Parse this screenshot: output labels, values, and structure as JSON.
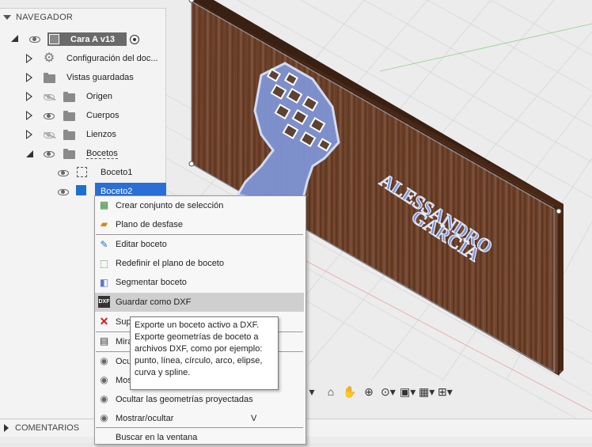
{
  "navigator": {
    "title": "NAVEGADOR",
    "component_name": "Cara A v13",
    "items": [
      {
        "label": "Configuración del doc...",
        "icon": "gear-icon"
      },
      {
        "label": "Vistas guardadas",
        "icon": "folder-icon"
      },
      {
        "label": "Origen",
        "icon": "folder-icon"
      },
      {
        "label": "Cuerpos",
        "icon": "folder-icon"
      },
      {
        "label": "Lienzos",
        "icon": "folder-icon"
      },
      {
        "label": "Bocetos",
        "icon": "folder-icon"
      }
    ],
    "sketches": [
      {
        "label": "Boceto1"
      },
      {
        "label": "Boceto2"
      }
    ]
  },
  "comments": {
    "title": "COMENTARIOS"
  },
  "canvas_text": {
    "line1": "ALESSANDRO",
    "line2": "GARCIA"
  },
  "context_menu": {
    "items": [
      {
        "label": "Crear conjunto de selección",
        "icon": "selection-set-icon"
      },
      {
        "label": "Plano de desfase",
        "icon": "offset-plane-icon"
      },
      {
        "label": "Editar boceto",
        "icon": "edit-sketch-icon"
      },
      {
        "label": "Redefinir el plano de boceto",
        "icon": "redefine-plane-icon"
      },
      {
        "label": "Segmentar boceto",
        "icon": "slice-sketch-icon"
      },
      {
        "label": "Guardar como DXF",
        "icon": "dxf-icon"
      },
      {
        "label": "Sup",
        "icon": "delete-icon"
      },
      {
        "label": "Mira",
        "icon": "look-at-icon"
      },
      {
        "label": "Ocu",
        "icon": "eye-icon"
      },
      {
        "label": "Mos",
        "icon": "eye-icon"
      },
      {
        "label": "Ocultar las geometrías proyectadas",
        "icon": "eye-icon"
      },
      {
        "label": "Mostrar/ocultar",
        "icon": "eye-icon",
        "shortcut": "V"
      },
      {
        "label": "Buscar en la ventana",
        "icon": ""
      }
    ]
  },
  "tooltip": {
    "lines": [
      "Exporte un boceto activo a DXF.",
      "Exporte geometrías de boceto a",
      "archivos DXF, como por ejemplo:",
      "punto, línea, círculo, arco, elipse,",
      "curva y spline."
    ]
  }
}
